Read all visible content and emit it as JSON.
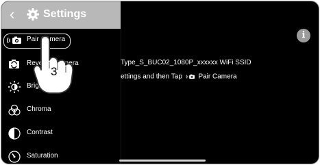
{
  "header": {
    "back_icon": "chevron-left-icon",
    "title": "Settings",
    "icon": "gear-icon"
  },
  "sidebar": {
    "items": [
      {
        "label": "Pair Camera",
        "icon": "pair-camera-icon"
      },
      {
        "label": "Reverse Camera",
        "icon": "reverse-camera-icon"
      },
      {
        "label": "Brightness",
        "icon": "brightness-icon"
      },
      {
        "label": "Chroma",
        "icon": "chroma-icon"
      },
      {
        "label": "Contrast",
        "icon": "contrast-icon"
      },
      {
        "label": "Saturation",
        "icon": "saturation-icon"
      }
    ]
  },
  "main": {
    "line1": "Type_S_BUC02_1080P_xxxxxx WiFi SSID",
    "line2_prefix": "ettings and then Tap",
    "line2_suffix": "Pair Camera",
    "info_icon": "info-icon"
  },
  "annotation": {
    "step": "3"
  },
  "colors": {
    "header_bg": "#b8b8b8",
    "screen_bg": "#000000",
    "text": "#ffffff",
    "info_bg": "#9b9b9b"
  }
}
